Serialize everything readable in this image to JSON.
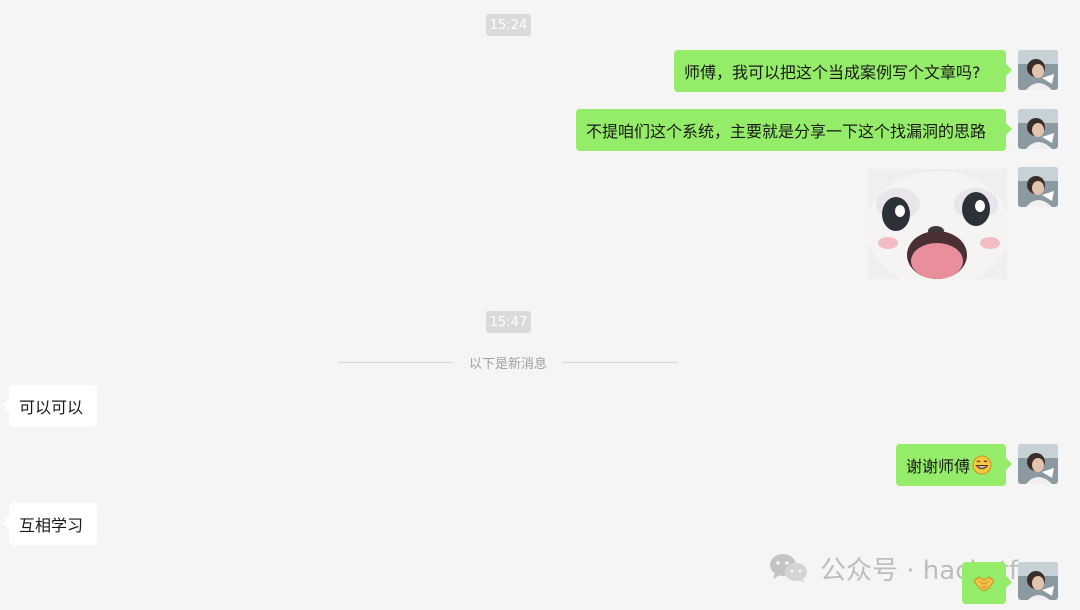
{
  "timestamps": [
    "15:24",
    "15:47"
  ],
  "divider": {
    "text": "以下是新消息"
  },
  "messages": [
    {
      "side": "me",
      "type": "text",
      "text": "师傅，我可以把这个当成案例写个文章吗?"
    },
    {
      "side": "me",
      "type": "text",
      "text": "不提咱们这个系统，主要就是分享一下这个找漏洞的思路"
    },
    {
      "side": "me",
      "type": "sticker",
      "icon": "surprised-bunny-sticker"
    },
    {
      "side": "other",
      "type": "text",
      "text": "可以可以"
    },
    {
      "side": "me",
      "type": "text",
      "text": "谢谢师傅",
      "emoji": "grin-emoji"
    },
    {
      "side": "other",
      "type": "text",
      "text": "互相学习"
    },
    {
      "side": "me",
      "type": "emoji",
      "icon": "handshake-emoji"
    }
  ],
  "watermark": {
    "text": "公众号 · hackctf",
    "icon": "wechat-logo"
  },
  "colors": {
    "me_bubble": "#95ec69",
    "other_bubble": "#ffffff",
    "background": "#f5f5f5",
    "timestamp_bg": "#dadada"
  }
}
